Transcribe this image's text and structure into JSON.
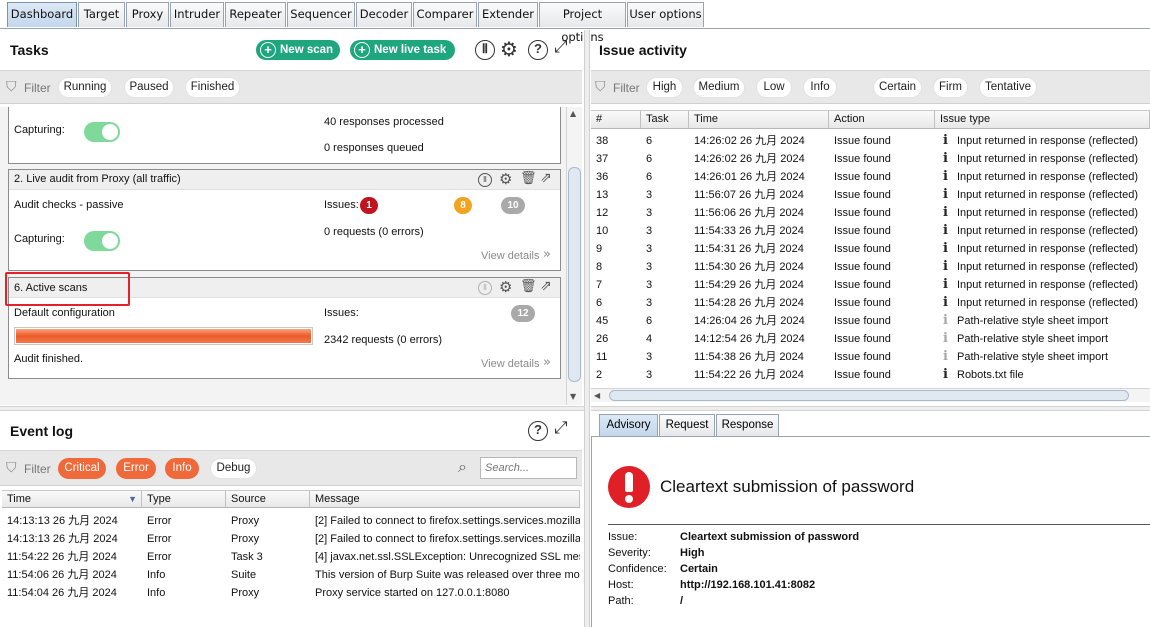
{
  "tabs": [
    "Dashboard",
    "Target",
    "Proxy",
    "Intruder",
    "Repeater",
    "Sequencer",
    "Decoder",
    "Comparer",
    "Extender",
    "Project options",
    "User options"
  ],
  "active_tab": "Dashboard",
  "tasks": {
    "title": "Tasks",
    "new_scan": "New scan",
    "new_live_task": "New live task",
    "filter_label": "Filter",
    "filters": [
      "Running",
      "Paused",
      "Finished"
    ],
    "card1": {
      "capturing_label": "Capturing:",
      "responses_processed": "40 responses processed",
      "responses_queued": "0 responses queued"
    },
    "card2": {
      "title": "2. Live audit from Proxy (all traffic)",
      "subtitle": "Audit checks - passive",
      "issues_label": "Issues:",
      "issues_high": "1",
      "issues_medium": "8",
      "issues_info": "10",
      "capturing_label": "Capturing:",
      "requests": "0 requests (0 errors)",
      "view_details": "View details"
    },
    "card3": {
      "title": "6. Active scans",
      "subtitle": "Default configuration",
      "issues_label": "Issues:",
      "issues_info": "12",
      "requests": "2342 requests (0 errors)",
      "status": "Audit finished.",
      "view_details": "View details",
      "progress": 1.0
    }
  },
  "event_log": {
    "title": "Event log",
    "filter_label": "Filter",
    "filters": [
      "Critical",
      "Error",
      "Info",
      "Debug"
    ],
    "search_placeholder": "Search...",
    "columns": [
      "Time",
      "Type",
      "Source",
      "Message"
    ],
    "rows": [
      {
        "time": "14:13:13 26 九月 2024",
        "type": "Error",
        "source": "Proxy",
        "message": "[2]  Failed to connect to firefox.settings.services.mozilla"
      },
      {
        "time": "14:13:13 26 九月 2024",
        "type": "Error",
        "source": "Proxy",
        "message": "[2]  Failed to connect to firefox.settings.services.mozilla"
      },
      {
        "time": "11:54:22 26 九月 2024",
        "type": "Error",
        "source": "Task 3",
        "message": "[4]  javax.net.ssl.SSLException: Unrecognized SSL mes"
      },
      {
        "time": "11:54:06 26 九月 2024",
        "type": "Info",
        "source": "Suite",
        "message": "This version of Burp Suite was released over three mo"
      },
      {
        "time": "11:54:04 26 九月 2024",
        "type": "Info",
        "source": "Proxy",
        "message": "Proxy service started on 127.0.0.1:8080"
      }
    ]
  },
  "issue_activity": {
    "title": "Issue activity",
    "filter_label": "Filter",
    "severity_filters": [
      "High",
      "Medium",
      "Low",
      "Info"
    ],
    "confidence_filters": [
      "Certain",
      "Firm",
      "Tentative"
    ],
    "columns": [
      "#",
      "Task",
      "Time",
      "Action",
      "Issue type"
    ],
    "rows": [
      {
        "num": "38",
        "task": "6",
        "time": "14:26:02 26 九月 2024",
        "action": "Issue found",
        "type": "Input returned in response (reflected)",
        "sev": "info"
      },
      {
        "num": "37",
        "task": "6",
        "time": "14:26:02 26 九月 2024",
        "action": "Issue found",
        "type": "Input returned in response (reflected)",
        "sev": "info"
      },
      {
        "num": "36",
        "task": "6",
        "time": "14:26:01 26 九月 2024",
        "action": "Issue found",
        "type": "Input returned in response (reflected)",
        "sev": "info"
      },
      {
        "num": "13",
        "task": "3",
        "time": "11:56:07 26 九月 2024",
        "action": "Issue found",
        "type": "Input returned in response (reflected)",
        "sev": "info"
      },
      {
        "num": "12",
        "task": "3",
        "time": "11:56:06 26 九月 2024",
        "action": "Issue found",
        "type": "Input returned in response (reflected)",
        "sev": "info"
      },
      {
        "num": "10",
        "task": "3",
        "time": "11:54:33 26 九月 2024",
        "action": "Issue found",
        "type": "Input returned in response (reflected)",
        "sev": "info"
      },
      {
        "num": "9",
        "task": "3",
        "time": "11:54:31 26 九月 2024",
        "action": "Issue found",
        "type": "Input returned in response (reflected)",
        "sev": "info"
      },
      {
        "num": "8",
        "task": "3",
        "time": "11:54:30 26 九月 2024",
        "action": "Issue found",
        "type": "Input returned in response (reflected)",
        "sev": "info"
      },
      {
        "num": "7",
        "task": "3",
        "time": "11:54:29 26 九月 2024",
        "action": "Issue found",
        "type": "Input returned in response (reflected)",
        "sev": "info"
      },
      {
        "num": "6",
        "task": "3",
        "time": "11:54:28 26 九月 2024",
        "action": "Issue found",
        "type": "Input returned in response (reflected)",
        "sev": "info"
      },
      {
        "num": "45",
        "task": "6",
        "time": "14:26:04 26 九月 2024",
        "action": "Issue found",
        "type": "Path-relative style sheet import",
        "sev": "tentative"
      },
      {
        "num": "26",
        "task": "4",
        "time": "14:12:54 26 九月 2024",
        "action": "Issue found",
        "type": "Path-relative style sheet import",
        "sev": "tentative"
      },
      {
        "num": "11",
        "task": "3",
        "time": "11:54:38 26 九月 2024",
        "action": "Issue found",
        "type": "Path-relative style sheet import",
        "sev": "tentative"
      },
      {
        "num": "2",
        "task": "3",
        "time": "11:54:22 26 九月 2024",
        "action": "Issue found",
        "type": "Robots.txt file",
        "sev": "info"
      }
    ]
  },
  "advisory": {
    "tabs": [
      "Advisory",
      "Request",
      "Response"
    ],
    "active": "Advisory",
    "title": "Cleartext submission of password",
    "fields": [
      {
        "label": "Issue:",
        "value": "Cleartext submission of password"
      },
      {
        "label": "Severity:",
        "value": "High"
      },
      {
        "label": "Confidence:",
        "value": "Certain"
      },
      {
        "label": "Host:",
        "value": "http://192.168.101.41:8082"
      },
      {
        "label": "Path:",
        "value": "/"
      }
    ]
  },
  "colors": {
    "accent_green": "#1ea77f",
    "high": "#c0151c",
    "medium": "#f2a421",
    "info_badge": "#a9a9a9",
    "highlight_box": "#e5202a",
    "filter_orange": "#f0693a"
  }
}
